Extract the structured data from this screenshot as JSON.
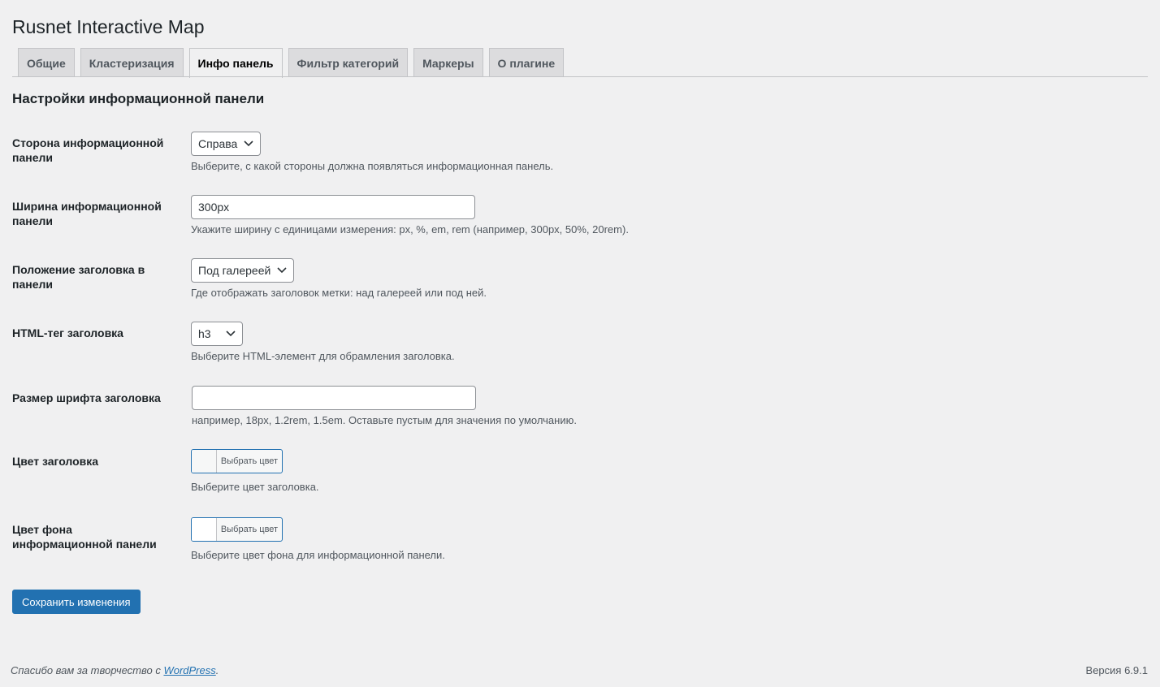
{
  "page": {
    "title": "Rusnet Interactive Map",
    "section_title": "Настройки информационной панели",
    "save_label": "Сохранить изменения"
  },
  "tabs": [
    {
      "label": "Общие",
      "active": false
    },
    {
      "label": "Кластеризация",
      "active": false
    },
    {
      "label": "Инфо панель",
      "active": true
    },
    {
      "label": "Фильтр категорий",
      "active": false
    },
    {
      "label": "Маркеры",
      "active": false
    },
    {
      "label": "О плагине",
      "active": false
    }
  ],
  "fields": {
    "side": {
      "label": "Сторона информационной панели",
      "value": "Справа",
      "description": "Выберите, с какой стороны должна появляться информационная панель."
    },
    "width": {
      "label": "Ширина информационной панели",
      "value": "300px",
      "description": "Укажите ширину с единицами измерения: px, %, em, rem (например, 300px, 50%, 20rem)."
    },
    "title_position": {
      "label": "Положение заголовка в панели",
      "value": "Под галереей",
      "description": "Где отображать заголовок метки: над галереей или под ней."
    },
    "title_tag": {
      "label": "HTML-тег заголовка",
      "value": "h3",
      "description": "Выберите HTML-элемент для обрамления заголовка."
    },
    "title_font_size": {
      "label": "Размер шрифта заголовка",
      "value": "",
      "description": "например, 18px, 1.2rem, 1.5em. Оставьте пустым для значения по умолчанию."
    },
    "title_color": {
      "label": "Цвет заголовка",
      "button_label": "Выбрать цвет",
      "swatch_color": "#f6f7f7",
      "description": "Выберите цвет заголовка."
    },
    "panel_bg_color": {
      "label": "Цвет фона информационной панели",
      "button_label": "Выбрать цвет",
      "swatch_color": "#ffffff",
      "description": "Выберите цвет фона для информационной панели."
    }
  },
  "footer": {
    "thanks_prefix": "Спасибо вам за творчество с ",
    "thanks_link": "WordPress",
    "thanks_suffix": ".",
    "version": "Версия 6.9.1"
  },
  "colors": {
    "accent": "#2271b1",
    "background": "#f0f0f1"
  }
}
